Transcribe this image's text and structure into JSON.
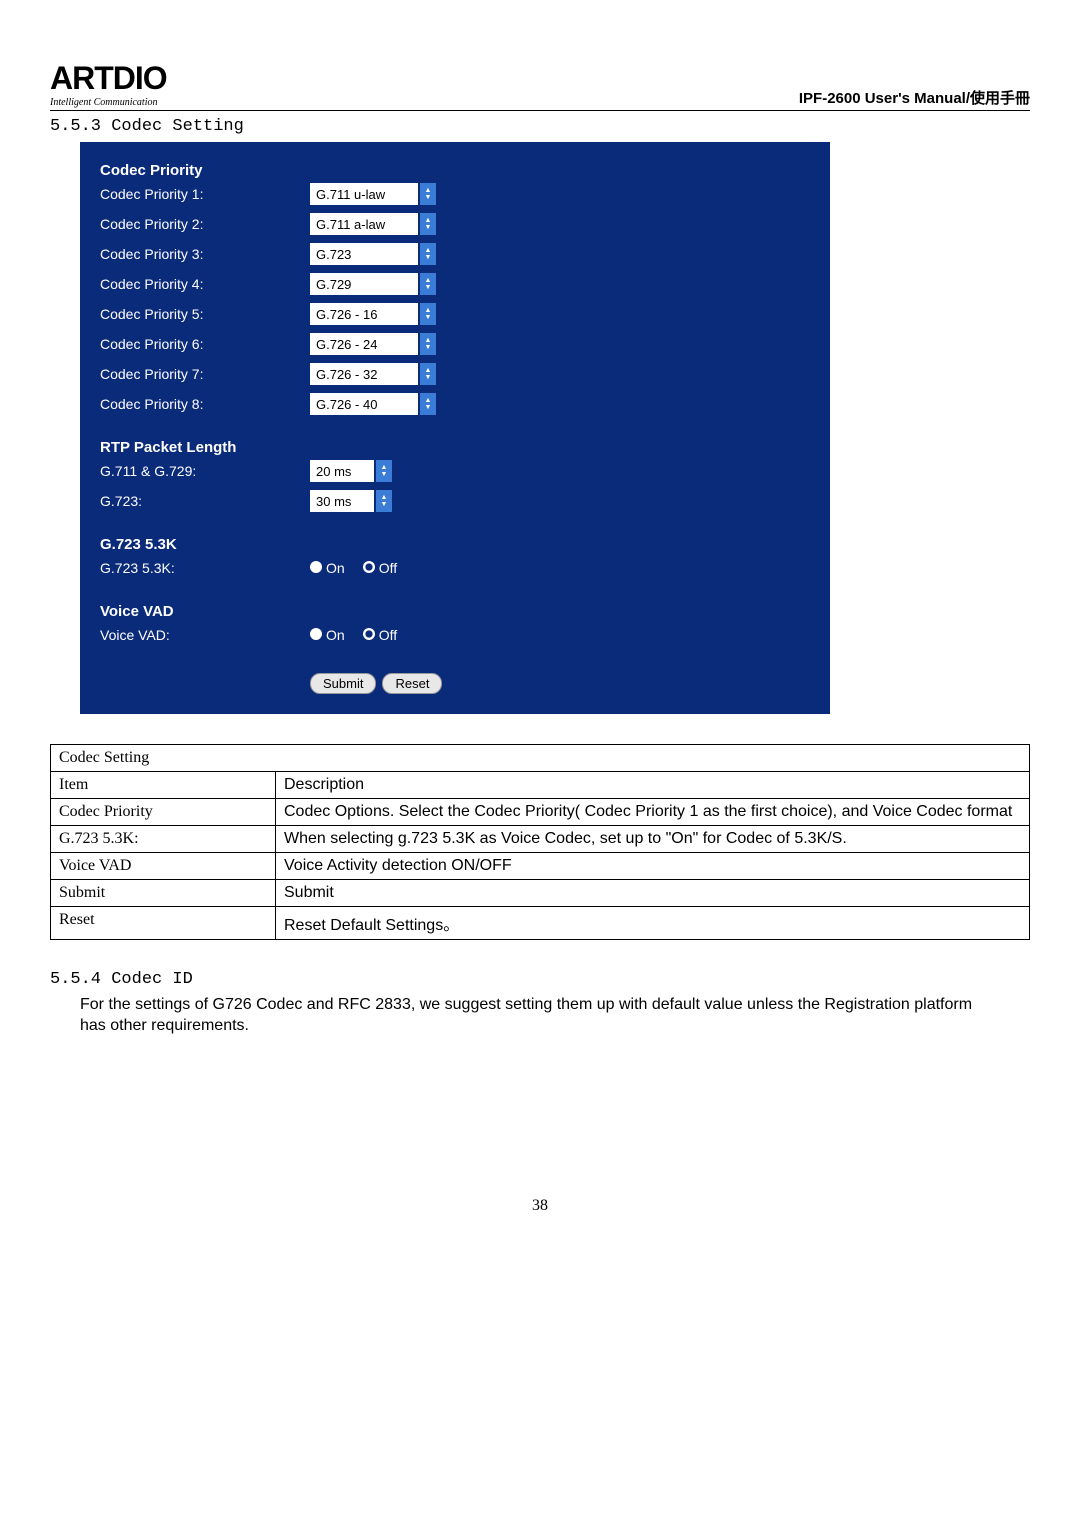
{
  "logo": {
    "main": "ARTDIO",
    "sub": "Intelligent Communication"
  },
  "manual_title": "IPF-2600 User's Manual/使用手冊",
  "section_a": "5.5.3 Codec Setting",
  "panel": {
    "codec_priority_heading": "Codec Priority",
    "rows": [
      {
        "label": "Codec Priority 1:",
        "value": "G.711 u-law"
      },
      {
        "label": "Codec Priority 2:",
        "value": "G.711 a-law"
      },
      {
        "label": "Codec Priority 3:",
        "value": "G.723"
      },
      {
        "label": "Codec Priority 4:",
        "value": "G.729"
      },
      {
        "label": "Codec Priority 5:",
        "value": "G.726 - 16"
      },
      {
        "label": "Codec Priority 6:",
        "value": "G.726 - 24"
      },
      {
        "label": "Codec Priority 7:",
        "value": "G.726 - 32"
      },
      {
        "label": "Codec Priority 8:",
        "value": "G.726 - 40"
      }
    ],
    "rtp_heading": "RTP Packet Length",
    "rtp_rows": [
      {
        "label": "G.711 & G.729:",
        "value": "20 ms"
      },
      {
        "label": "G.723:",
        "value": "30 ms"
      }
    ],
    "g723_heading": "G.723 5.3K",
    "g723_label": "G.723 5.3K:",
    "vad_heading": "Voice VAD",
    "vad_label": "Voice VAD:",
    "on": "On",
    "off": "Off",
    "submit": "Submit",
    "reset": "Reset"
  },
  "table": {
    "r1c1": "Codec Setting",
    "r2c1": "Item",
    "r2c2": "Description",
    "r3c1": "Codec Priority",
    "r3c2": "Codec Options. Select the Codec Priority( Codec Priority 1 as the first choice), and Voice Codec format",
    "r4c1": "G.723 5.3K:",
    "r4c2": "When selecting g.723 5.3K as Voice Codec, set up to \"On\" for Codec of 5.3K/S.",
    "r5c1": "Voice VAD",
    "r5c2": "Voice Activity detection ON/OFF",
    "r6c1": "Submit",
    "r6c2": "Submit",
    "r7c1": "Reset",
    "r7c2": "Reset Default Settings。"
  },
  "section_b": "5.5.4 Codec ID",
  "para_b": "For the settings of G726 Codec and RFC 2833, we suggest setting them up with default value unless the Registration platform has other requirements.",
  "page": "38"
}
